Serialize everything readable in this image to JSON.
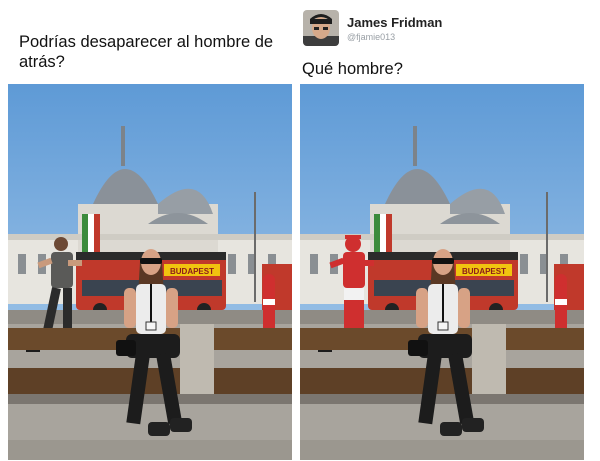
{
  "request": {
    "text": "Podrías  desaparecer al hombre de atrás?"
  },
  "author": {
    "name": "James Fridman",
    "handle": "@fjamie013"
  },
  "reply": {
    "text": "Qué hombre?"
  },
  "banner": {
    "text": "BUDAPEST"
  },
  "colors": {
    "sky": "#7fb1e0",
    "bus_red": "#c0392b",
    "pavement": "#a8a49d",
    "bench": "#6b4a2b"
  }
}
